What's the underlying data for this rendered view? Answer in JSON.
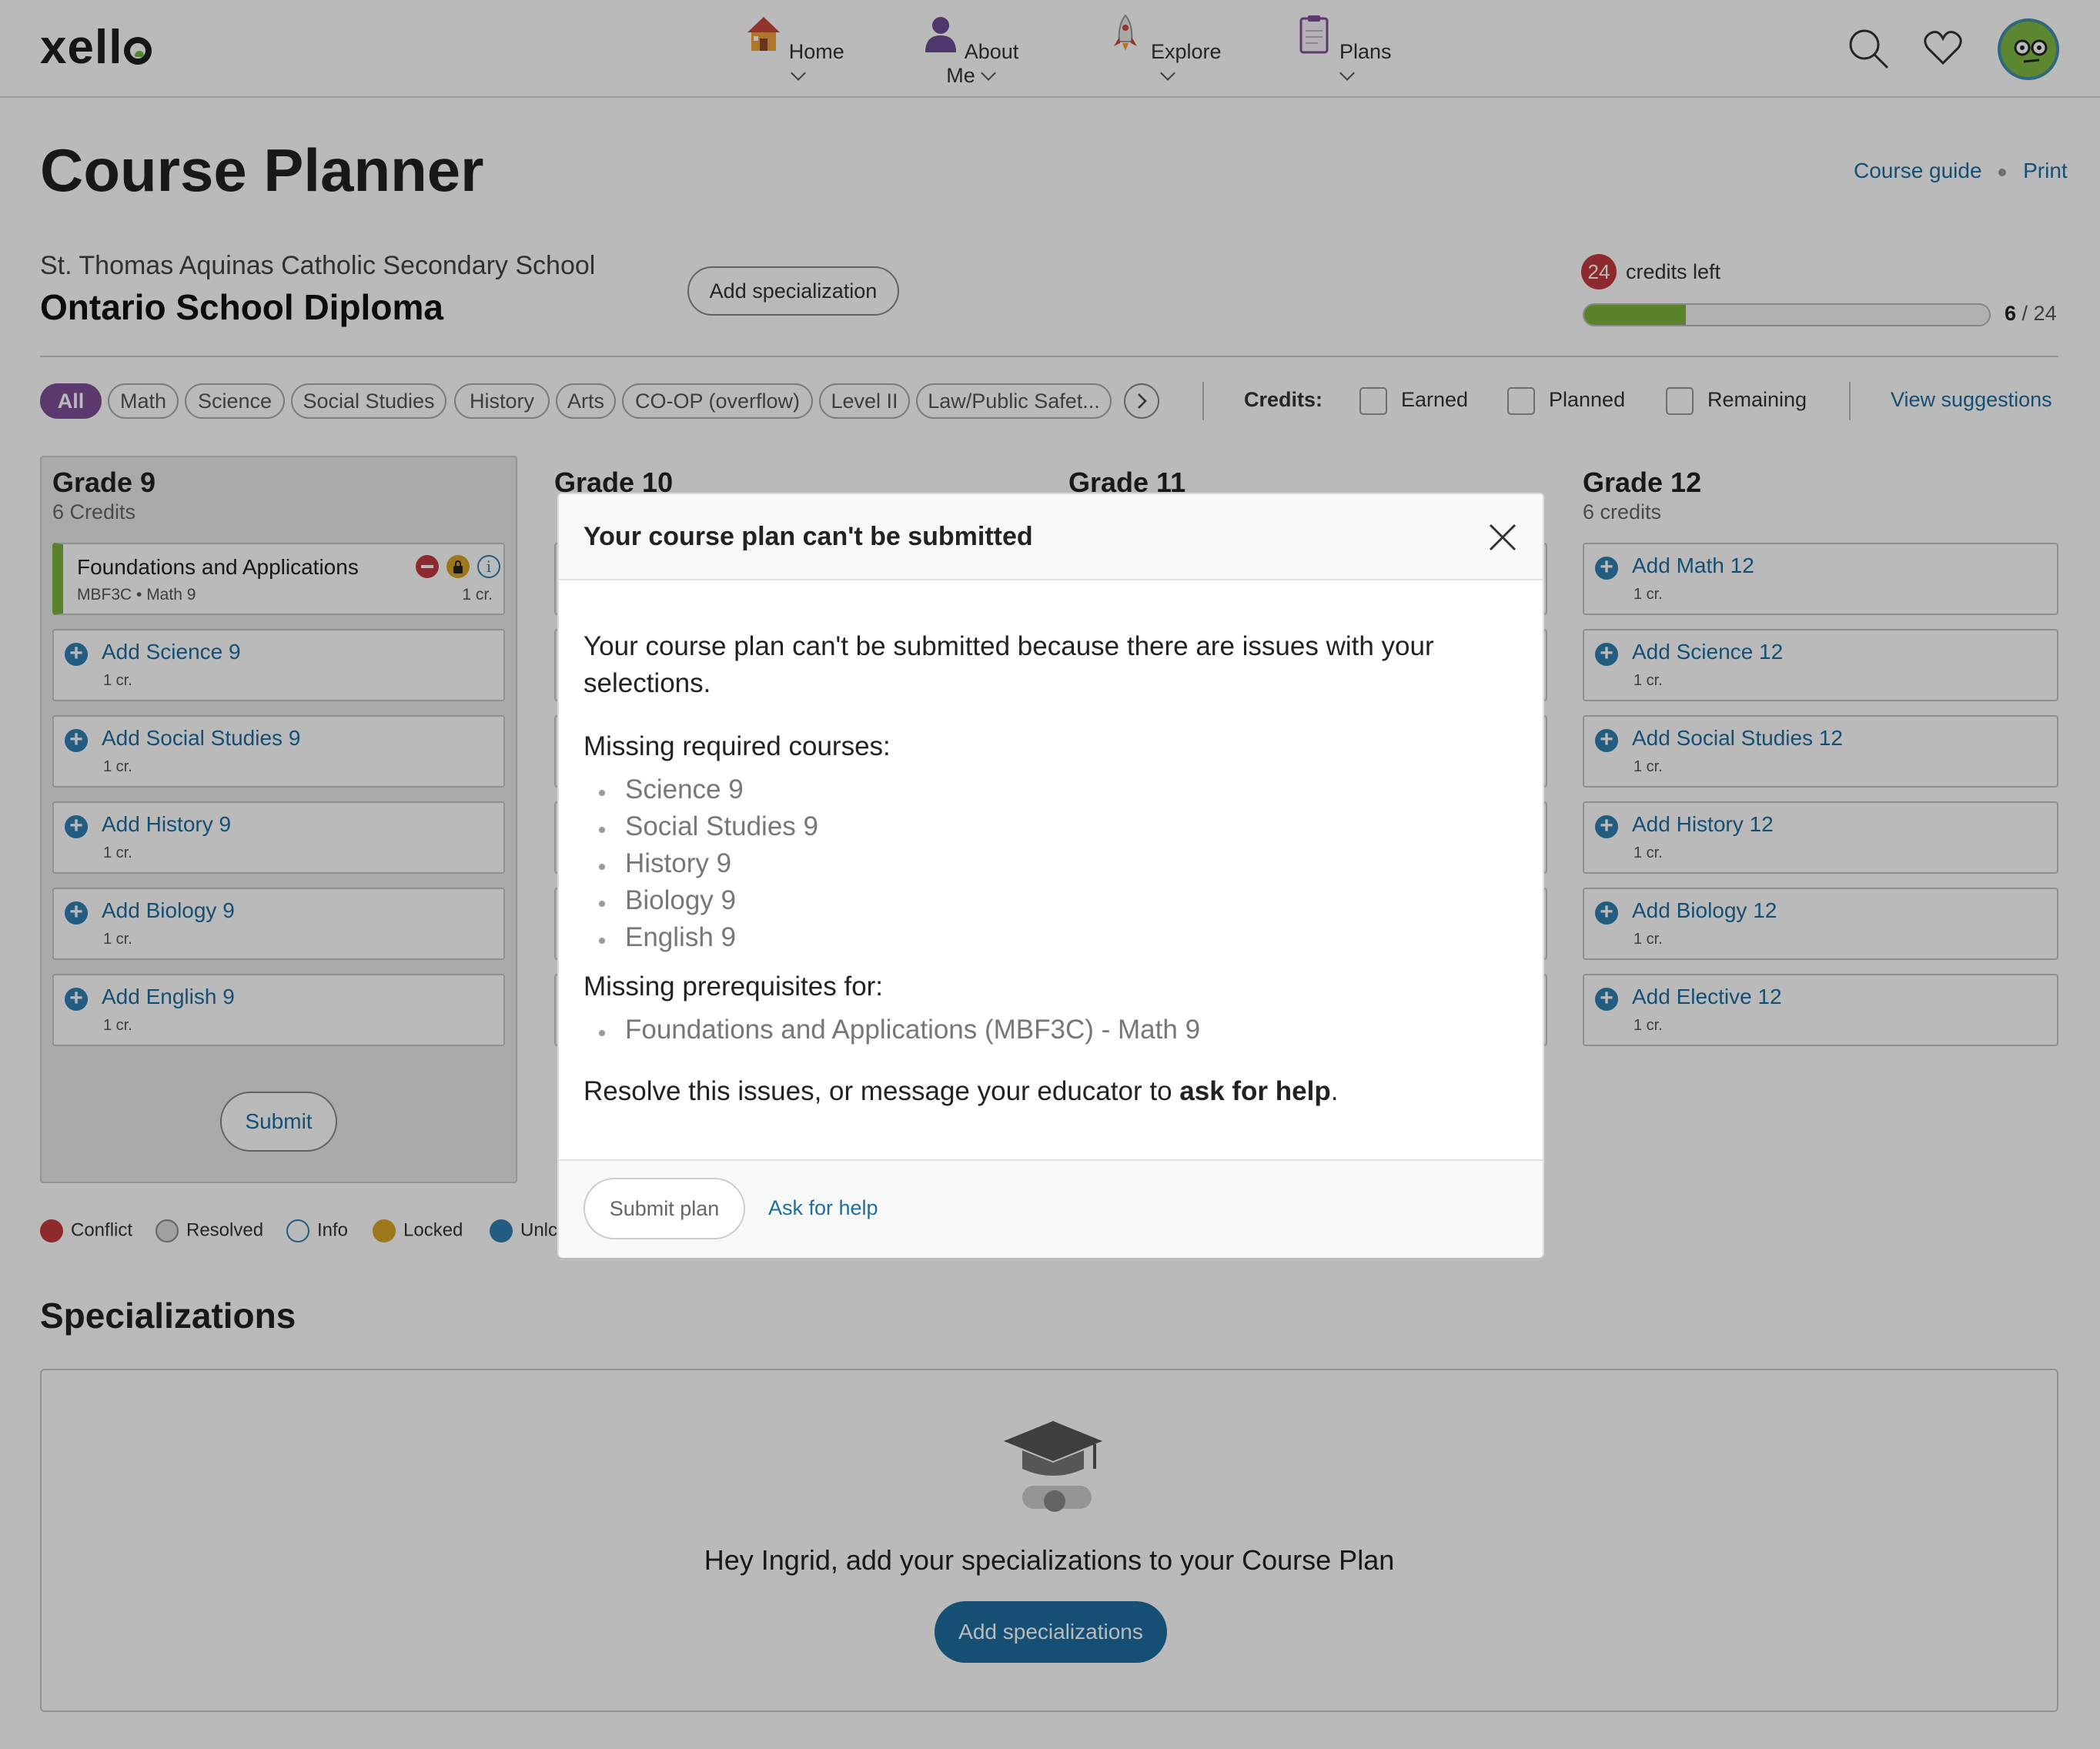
{
  "header": {
    "logo": "xello",
    "nav": [
      {
        "label": "Home",
        "icon": "house-icon"
      },
      {
        "label": "About Me",
        "icon": "person-icon"
      },
      {
        "label": "Explore",
        "icon": "rocket-icon"
      },
      {
        "label": "Plans",
        "icon": "clipboard-icon"
      }
    ]
  },
  "page": {
    "title": "Course Planner",
    "links": {
      "course_guide": "Course guide",
      "print": "Print"
    },
    "school": "St. Thomas Aquinas Catholic Secondary School",
    "diploma": "Ontario School Diploma",
    "add_specialization_label": "Add specialization",
    "credits": {
      "left": "24",
      "left_label": "credits left",
      "earned": "6",
      "total": "/ 24",
      "fraction": 0.25
    }
  },
  "filters": {
    "chips": [
      "All",
      "Math",
      "Science",
      "Social Studies",
      "History",
      "Arts",
      "CO-OP (overflow)",
      "Level II",
      "Law/Public Safet..."
    ],
    "credits_label": "Credits:",
    "checkboxes": [
      "Earned",
      "Planned",
      "Remaining"
    ],
    "view_suggestions": "View suggestions"
  },
  "grades": {
    "g9": {
      "title": "Grade 9",
      "sub": "6 Credits",
      "course": {
        "name": "Foundations and Applications",
        "code": "MBF3C • Math 9",
        "credit": "1 cr."
      },
      "adds": [
        {
          "label": "Add Science 9",
          "credit": "1 cr."
        },
        {
          "label": "Add Social Studies 9",
          "credit": "1 cr."
        },
        {
          "label": "Add History 9",
          "credit": "1 cr."
        },
        {
          "label": "Add Biology 9",
          "credit": "1 cr."
        },
        {
          "label": "Add English 9",
          "credit": "1 cr."
        }
      ],
      "submit": "Submit"
    },
    "g10": {
      "title": "Grade 10"
    },
    "g11": {
      "title": "Grade 11"
    },
    "g12": {
      "title": "Grade 12",
      "sub": "6 credits",
      "adds": [
        {
          "label": "Add Math 12",
          "credit": "1 cr."
        },
        {
          "label": "Add Science 12",
          "credit": "1 cr."
        },
        {
          "label": "Add Social Studies 12",
          "credit": "1 cr."
        },
        {
          "label": "Add History 12",
          "credit": "1 cr."
        },
        {
          "label": "Add Biology 12",
          "credit": "1 cr."
        },
        {
          "label": "Add Elective 12",
          "credit": "1 cr."
        }
      ]
    }
  },
  "legend": [
    "Conflict",
    "Resolved",
    "Info",
    "Locked",
    "Unlc"
  ],
  "specializations": {
    "title": "Specializations",
    "message": "Hey Ingrid, add your specializations to your Course Plan",
    "button": "Add specializations"
  },
  "modal": {
    "title": "Your course plan can't be submitted",
    "intro": "Your course plan can't be submitted because there are issues with your selections.",
    "missing_required_label": "Missing required courses:",
    "missing_required": [
      "Science 9",
      "Social Studies 9",
      "History 9",
      "Biology 9",
      "English 9"
    ],
    "missing_prereq_label": "Missing prerequisites for:",
    "missing_prereq": [
      "Foundations and Applications (MBF3C) - Math 9"
    ],
    "resolve_text": "Resolve this issues, or message your educator to",
    "resolve_bold": "ask for help",
    "resolve_end": ".",
    "submit_plan": "Submit plan",
    "ask_for_help": "Ask for help"
  },
  "colors": {
    "accent": "#1e6da0",
    "purple": "#7d4f97",
    "progress": "#7ab23b",
    "conflict": "#c23a3f",
    "locked": "#d8a424"
  }
}
